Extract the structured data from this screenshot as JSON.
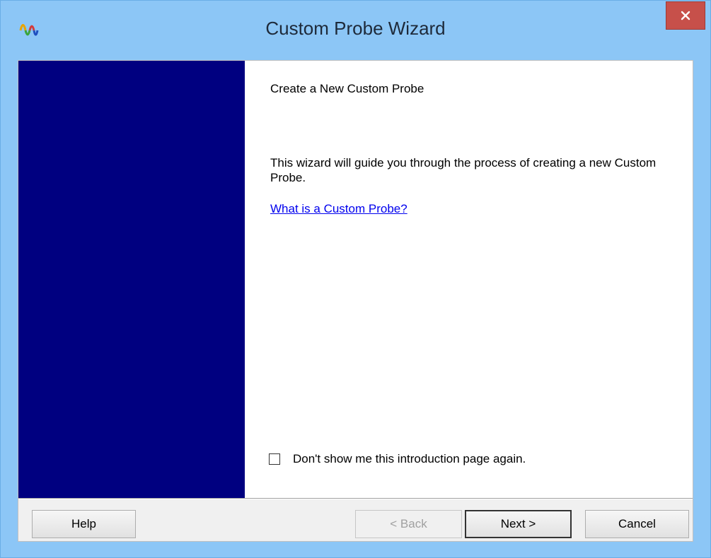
{
  "window": {
    "title": "Custom Probe Wizard",
    "close_glyph": "✕"
  },
  "colors": {
    "title_bar": "#8cc6f6",
    "close_button": "#c7504a",
    "side_panel": "#000080",
    "link": "#0000ee"
  },
  "icons": {
    "app": "waveform-probe-icon",
    "close": "close-icon"
  },
  "page": {
    "heading": "Create a New Custom Probe",
    "intro": "This wizard will guide you through the process of creating a new Custom Probe.",
    "link": "What is a Custom Probe?",
    "checkbox": {
      "label": "Don't show me this introduction page again.",
      "checked": false
    }
  },
  "buttons": {
    "help": "Help",
    "back": "< Back",
    "next": "Next >",
    "cancel": "Cancel"
  }
}
